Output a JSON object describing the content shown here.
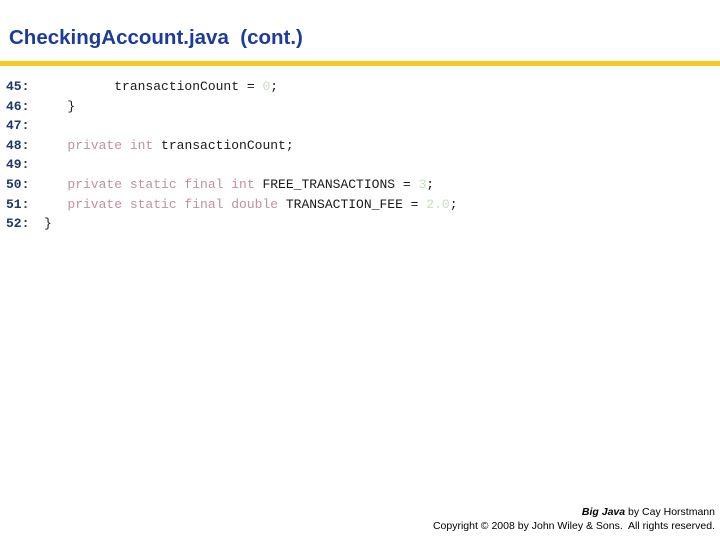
{
  "slide": {
    "title": "CheckingAccount.java  (cont.)",
    "accent_color": "#f7ca20",
    "title_color": "#1c3b9b",
    "line_number_color": "#1f3864",
    "keyword_color": "#c0929e",
    "literal_color": "#c9dcc2",
    "identifier_color": "#1a1a1a"
  },
  "code": {
    "language": "java",
    "first_line_number": 45,
    "last_line_number": 52,
    "lines": [
      {
        "number": "45:",
        "tokens": [
          {
            "text": "         transaction",
            "kind": "plain"
          },
          {
            "text": "Count = ",
            "kind": "plain"
          },
          {
            "text": "0",
            "kind": "num"
          },
          {
            "text": ";",
            "kind": "plain"
          }
        ],
        "plain": "         transactionCount = 0;"
      },
      {
        "number": "46:",
        "tokens": [
          {
            "text": "   }",
            "kind": "plain"
          }
        ],
        "plain": "   }"
      },
      {
        "number": "47:",
        "tokens": [],
        "plain": ""
      },
      {
        "number": "48:",
        "tokens": [
          {
            "text": "   ",
            "kind": "plain"
          },
          {
            "text": "private int",
            "kind": "kw"
          },
          {
            "text": " transactionCount;",
            "kind": "plain"
          }
        ],
        "plain": "   private int transactionCount;"
      },
      {
        "number": "49:",
        "tokens": [],
        "plain": ""
      },
      {
        "number": "50:",
        "tokens": [
          {
            "text": "   ",
            "kind": "plain"
          },
          {
            "text": "private static final int",
            "kind": "kw"
          },
          {
            "text": " FREE_TRANSACTIONS = ",
            "kind": "plain"
          },
          {
            "text": "3",
            "kind": "num"
          },
          {
            "text": ";",
            "kind": "plain"
          }
        ],
        "plain": "   private static final int FREE_TRANSACTIONS = 3;"
      },
      {
        "number": "51:",
        "tokens": [
          {
            "text": "   ",
            "kind": "plain"
          },
          {
            "text": "private static final double",
            "kind": "kw"
          },
          {
            "text": " TRANSACTION_FEE = ",
            "kind": "plain"
          },
          {
            "text": "2.0",
            "kind": "num"
          },
          {
            "text": ";",
            "kind": "plain"
          }
        ],
        "plain": "   private static final double TRANSACTION_FEE = 2.0;"
      },
      {
        "number": "52:",
        "tokens": [
          {
            "text": "}",
            "kind": "plain"
          }
        ],
        "plain": "}"
      }
    ]
  },
  "footer": {
    "book_title": "Big Java",
    "byline": " by Cay Horstmann",
    "copyright": "Copyright © 2008 by John Wiley & Sons.  All rights reserved."
  }
}
